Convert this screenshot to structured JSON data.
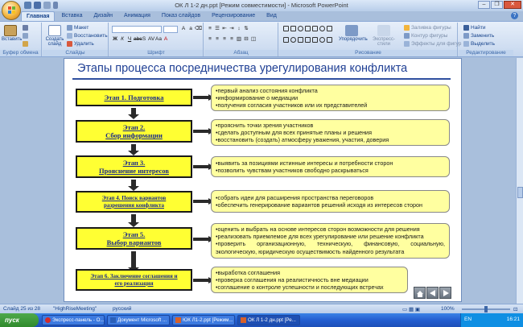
{
  "window": {
    "title": "ОК Л 1-2 дн.ppt [Режим совместимости] - Microsoft PowerPoint"
  },
  "tabs": [
    "Главная",
    "Вставка",
    "Дизайн",
    "Анимация",
    "Показ слайдов",
    "Рецензирование",
    "Вид"
  ],
  "ribbon": {
    "clipboard": {
      "paste": "Вставить",
      "cut": "Вырезать",
      "copy": "Копировать",
      "group": "Буфер обмена"
    },
    "slides": {
      "new_slide": "Создать слайд",
      "layout": "Макет",
      "reset": "Восстановить",
      "delete": "Удалить",
      "group": "Слайды"
    },
    "font": {
      "group": "Шрифт"
    },
    "paragraph": {
      "group": "Абзац"
    },
    "drawing": {
      "arrange": "Упорядочить",
      "quick_styles": "Экспресс-стили",
      "fill": "Заливка фигуры",
      "outline": "Контур фигуры",
      "effects": "Эффекты для фигур",
      "group": "Рисование"
    },
    "editing": {
      "find": "Найти",
      "replace": "Заменить",
      "select": "Выделить",
      "group": "Редактирование"
    }
  },
  "slide": {
    "title": "Этапы процесса посредничества урегулирования конфликта",
    "stages": [
      {
        "line1": "Этап 1. Подготовка",
        "line2": "",
        "bullets": [
          "•первый анализ состояния конфликта",
          "•информирование о медиации",
          "•получения согласия участников или их представителей"
        ]
      },
      {
        "line1": "Этап 2.",
        "line2": "Сбор информации",
        "bullets": [
          "•прояснить точки зрения участников",
          "•сделать доступным для всех принятые планы и решения",
          "•восстановить (создать) атмосферу уважения, участия, доверия"
        ]
      },
      {
        "line1": "Этап 3.",
        "line2": "Прояснение интересов",
        "bullets": [
          "•выявить за позициями истинные интересы и потребности сторон",
          "•позволить чувствам участников свободно раскрываться"
        ]
      },
      {
        "line1": "Этап 4. Поиск вариантов",
        "line2": "разрешения конфликта",
        "bullets": [
          "•собрать идеи для расширения пространства переговоров",
          "•обеспечить генерирование вариантов решений исходя из интересов сторон"
        ]
      },
      {
        "line1": "Этап 5.",
        "line2": "Выбор вариантов",
        "bullets": [
          "•оценить и выбрать на основе интересов сторон возможности для решения",
          "•реализовать приемлемое для всех урегулирование или решение конфликта",
          "•проверить организационную, техническую, финансовую, социальную, экологическую, юридическую осуществимость найденного результата"
        ]
      },
      {
        "line1": "Этап 6. Заключение соглашения и",
        "line2": "его реализация",
        "bullets": [
          "•выработка соглашения",
          "•проверка соглашения на реалистичность вне медиации",
          "•соглашение о контроле успешности и последующих встречах"
        ]
      }
    ]
  },
  "status": {
    "slide": "Слайд 25 из 28",
    "theme": "\"HighRiseMeeting\"",
    "language": "русский",
    "zoom": "100%"
  },
  "taskbar": {
    "start": "пуск",
    "tasks": [
      "Экспресс-панель - О...",
      "Документ Microsoft ...",
      "ЮК Л1-2.ppt [Режим...",
      "ОК Л 1-2 дн.ppt [Ре..."
    ],
    "lang": "EN",
    "clock": "16:21"
  }
}
